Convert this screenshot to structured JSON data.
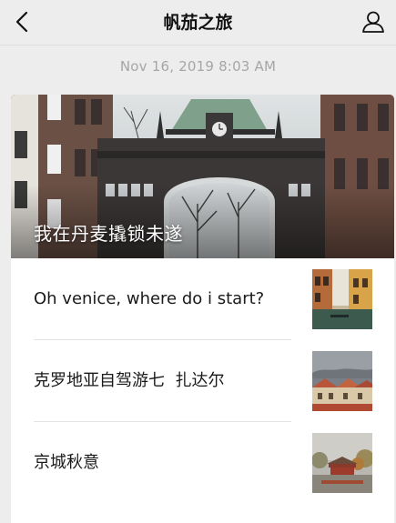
{
  "navbar": {
    "title": "帆茄之旅",
    "back_icon": "chevron-left-icon",
    "profile_icon": "person-icon"
  },
  "timestamp": "Nov 16, 2019 8:03 AM",
  "cover": {
    "title": "我在丹麦撬锁未遂"
  },
  "articles": [
    {
      "title": "Oh venice, where do i start?"
    },
    {
      "title": "克罗地亚自驾游七  扎达尔"
    },
    {
      "title": "京城秋意"
    }
  ],
  "colors": {
    "background": "#ededed",
    "card": "#ffffff",
    "timestamp": "#a6a6a6",
    "text": "#1a1a1a"
  }
}
